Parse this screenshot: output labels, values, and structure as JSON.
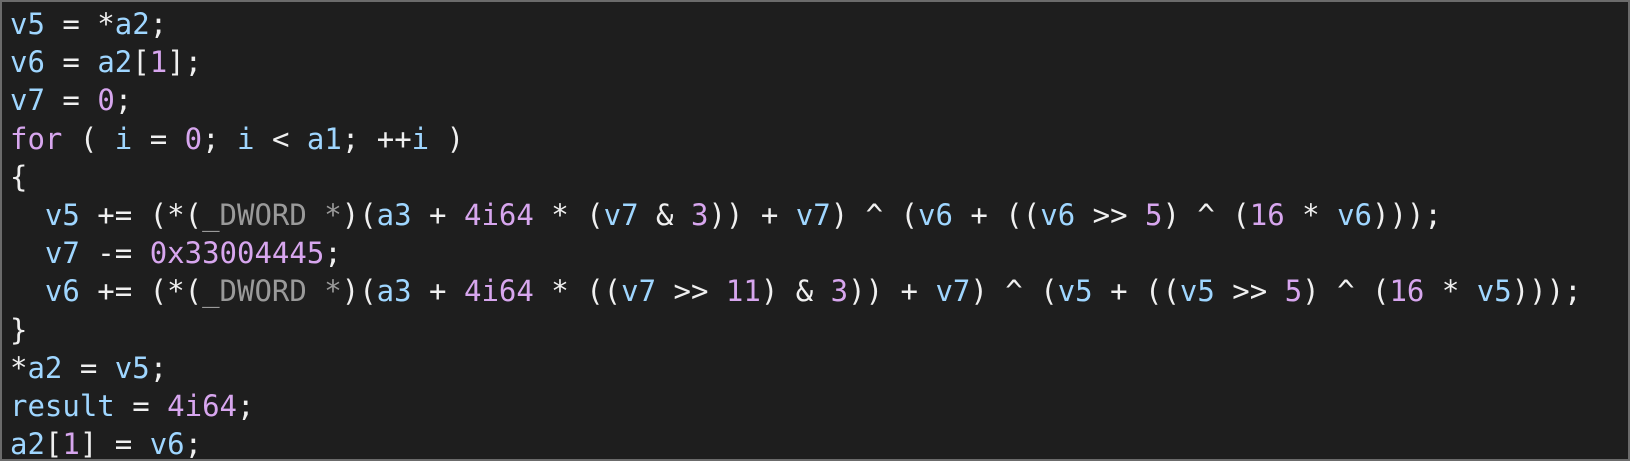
{
  "code_view": {
    "lines": [
      [
        {
          "t": "v5",
          "c": "var"
        },
        {
          "t": " = *",
          "c": "op"
        },
        {
          "t": "a2",
          "c": "var"
        },
        {
          "t": ";",
          "c": "op"
        }
      ],
      [
        {
          "t": "v6",
          "c": "var"
        },
        {
          "t": " = ",
          "c": "op"
        },
        {
          "t": "a2",
          "c": "var"
        },
        {
          "t": "[",
          "c": "op"
        },
        {
          "t": "1",
          "c": "num"
        },
        {
          "t": "];",
          "c": "op"
        }
      ],
      [
        {
          "t": "v7",
          "c": "var"
        },
        {
          "t": " = ",
          "c": "op"
        },
        {
          "t": "0",
          "c": "num"
        },
        {
          "t": ";",
          "c": "op"
        }
      ],
      [
        {
          "t": "for",
          "c": "kw"
        },
        {
          "t": " ( ",
          "c": "op"
        },
        {
          "t": "i",
          "c": "var"
        },
        {
          "t": " = ",
          "c": "op"
        },
        {
          "t": "0",
          "c": "num"
        },
        {
          "t": "; ",
          "c": "op"
        },
        {
          "t": "i",
          "c": "var"
        },
        {
          "t": " < ",
          "c": "op"
        },
        {
          "t": "a1",
          "c": "var"
        },
        {
          "t": "; ++",
          "c": "op"
        },
        {
          "t": "i",
          "c": "var"
        },
        {
          "t": " )",
          "c": "op"
        }
      ],
      [
        {
          "t": "{",
          "c": "op"
        }
      ],
      [
        {
          "t": "  ",
          "c": "op"
        },
        {
          "t": "v5",
          "c": "var"
        },
        {
          "t": " += (*(",
          "c": "op"
        },
        {
          "t": "_DWORD *",
          "c": "dim"
        },
        {
          "t": ")(",
          "c": "op"
        },
        {
          "t": "a3",
          "c": "var"
        },
        {
          "t": " + ",
          "c": "op"
        },
        {
          "t": "4i64",
          "c": "num"
        },
        {
          "t": " * (",
          "c": "op"
        },
        {
          "t": "v7",
          "c": "var"
        },
        {
          "t": " & ",
          "c": "op"
        },
        {
          "t": "3",
          "c": "num"
        },
        {
          "t": ")) + ",
          "c": "op"
        },
        {
          "t": "v7",
          "c": "var"
        },
        {
          "t": ") ^ (",
          "c": "op"
        },
        {
          "t": "v6",
          "c": "var"
        },
        {
          "t": " + ((",
          "c": "op"
        },
        {
          "t": "v6",
          "c": "var"
        },
        {
          "t": " >> ",
          "c": "op"
        },
        {
          "t": "5",
          "c": "num"
        },
        {
          "t": ") ^ (",
          "c": "op"
        },
        {
          "t": "16",
          "c": "num"
        },
        {
          "t": " * ",
          "c": "op"
        },
        {
          "t": "v6",
          "c": "var"
        },
        {
          "t": ")));",
          "c": "op"
        }
      ],
      [
        {
          "t": "  ",
          "c": "op"
        },
        {
          "t": "v7",
          "c": "var"
        },
        {
          "t": " -= ",
          "c": "op"
        },
        {
          "t": "0x33004445",
          "c": "num"
        },
        {
          "t": ";",
          "c": "op"
        }
      ],
      [
        {
          "t": "  ",
          "c": "op"
        },
        {
          "t": "v6",
          "c": "var"
        },
        {
          "t": " += (*(",
          "c": "op"
        },
        {
          "t": "_DWORD *",
          "c": "dim"
        },
        {
          "t": ")(",
          "c": "op"
        },
        {
          "t": "a3",
          "c": "var"
        },
        {
          "t": " + ",
          "c": "op"
        },
        {
          "t": "4i64",
          "c": "num"
        },
        {
          "t": " * ((",
          "c": "op"
        },
        {
          "t": "v7",
          "c": "var"
        },
        {
          "t": " >> ",
          "c": "op"
        },
        {
          "t": "11",
          "c": "num"
        },
        {
          "t": ") & ",
          "c": "op"
        },
        {
          "t": "3",
          "c": "num"
        },
        {
          "t": ")) + ",
          "c": "op"
        },
        {
          "t": "v7",
          "c": "var"
        },
        {
          "t": ") ^ (",
          "c": "op"
        },
        {
          "t": "v5",
          "c": "var"
        },
        {
          "t": " + ((",
          "c": "op"
        },
        {
          "t": "v5",
          "c": "var"
        },
        {
          "t": " >> ",
          "c": "op"
        },
        {
          "t": "5",
          "c": "num"
        },
        {
          "t": ") ^ (",
          "c": "op"
        },
        {
          "t": "16",
          "c": "num"
        },
        {
          "t": " * ",
          "c": "op"
        },
        {
          "t": "v5",
          "c": "var"
        },
        {
          "t": ")));",
          "c": "op"
        }
      ],
      [
        {
          "t": "}",
          "c": "op"
        }
      ],
      [
        {
          "t": "*",
          "c": "op"
        },
        {
          "t": "a2",
          "c": "var"
        },
        {
          "t": " = ",
          "c": "op"
        },
        {
          "t": "v5",
          "c": "var"
        },
        {
          "t": ";",
          "c": "op"
        }
      ],
      [
        {
          "t": "result",
          "c": "var"
        },
        {
          "t": " = ",
          "c": "op"
        },
        {
          "t": "4i64",
          "c": "num"
        },
        {
          "t": ";",
          "c": "op"
        }
      ],
      [
        {
          "t": "a2",
          "c": "var"
        },
        {
          "t": "[",
          "c": "op"
        },
        {
          "t": "1",
          "c": "num"
        },
        {
          "t": "] = ",
          "c": "op"
        },
        {
          "t": "v6",
          "c": "var"
        },
        {
          "t": ";",
          "c": "op"
        }
      ]
    ]
  },
  "colors": {
    "background": "#1e1e1e",
    "border": "#6b6b6b",
    "variable": "#9fd6ff",
    "number": "#d7a6ee",
    "keyword": "#d7a6ee",
    "operator": "#f0f0f0",
    "type_cast": "#9a9a9a"
  }
}
